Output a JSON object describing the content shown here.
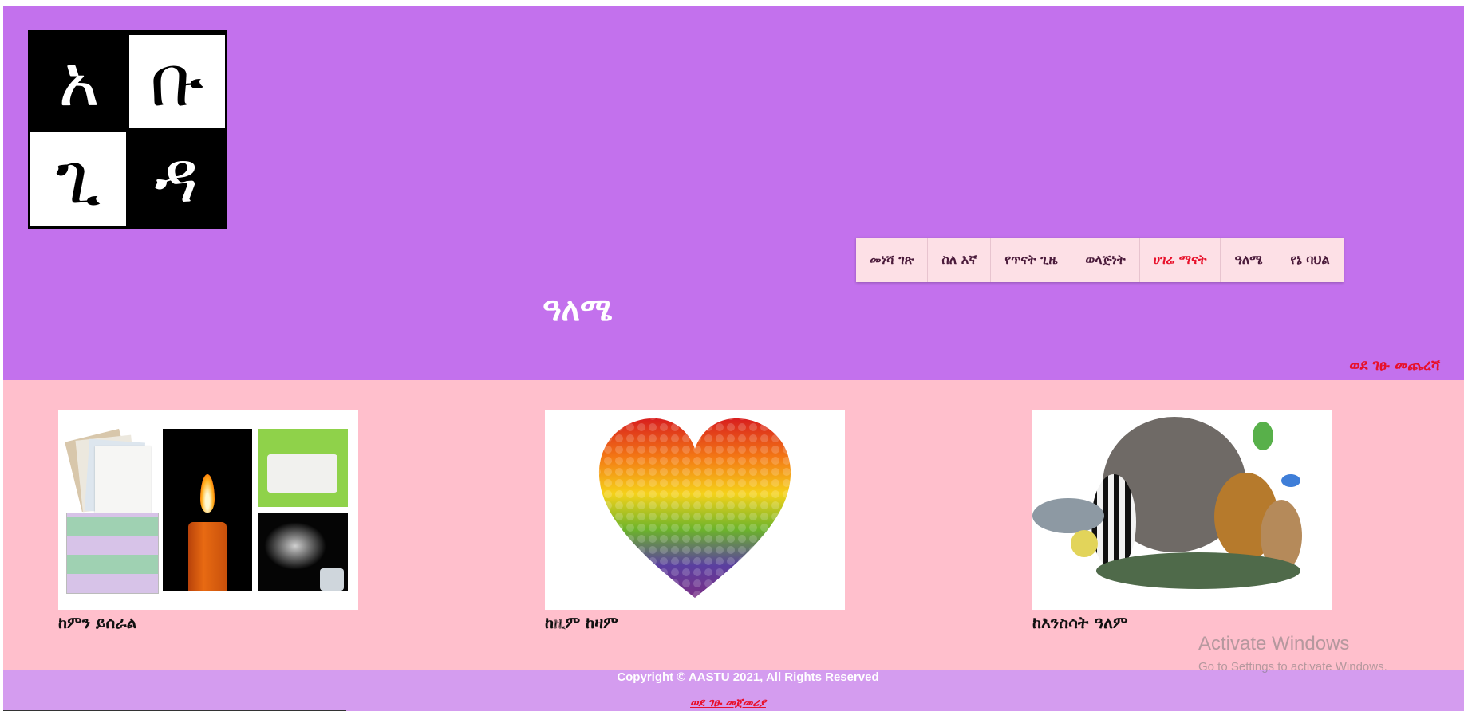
{
  "logo": {
    "letters": [
      "አ",
      "ቡ",
      "ጊ",
      "ዳ"
    ]
  },
  "nav": {
    "items": [
      {
        "label": "መነሻ ገጽ"
      },
      {
        "label": "ስለ እኛ"
      },
      {
        "label": "የጥናት ጊዜ"
      },
      {
        "label": "ወላጅነት"
      },
      {
        "label": "ሀገሬ ማናት",
        "active": true
      },
      {
        "label": "ዓለሜ"
      },
      {
        "label": "የኔ ባህል"
      }
    ]
  },
  "page": {
    "title": "ዓለሜ",
    "to_bottom_link": "ወደ ገፁ መጨረሻ"
  },
  "cards": [
    {
      "caption": "ከምን ይሰራል",
      "image": "collage-paper-candle-soap-money-perfume"
    },
    {
      "caption": "ከዚም ከዛም",
      "image": "fruit-vegetable-heart"
    },
    {
      "caption": "ከእንስሳት ዓለም",
      "image": "animals-group"
    }
  ],
  "footer": {
    "copyright": "Copyright © AASTU 2021, All Rights Reserved",
    "to_top_link": "ወደ ገፁ መጀመሪያ"
  },
  "watermark": {
    "line1": "Activate Windows",
    "line2": "Go to Settings to activate Windows."
  },
  "colors": {
    "header_bg": "#c371ed",
    "content_bg": "#ffbfcc",
    "footer_bg": "#d49cef",
    "nav_bg": "#fde0e6",
    "link_red": "#e8102a"
  }
}
